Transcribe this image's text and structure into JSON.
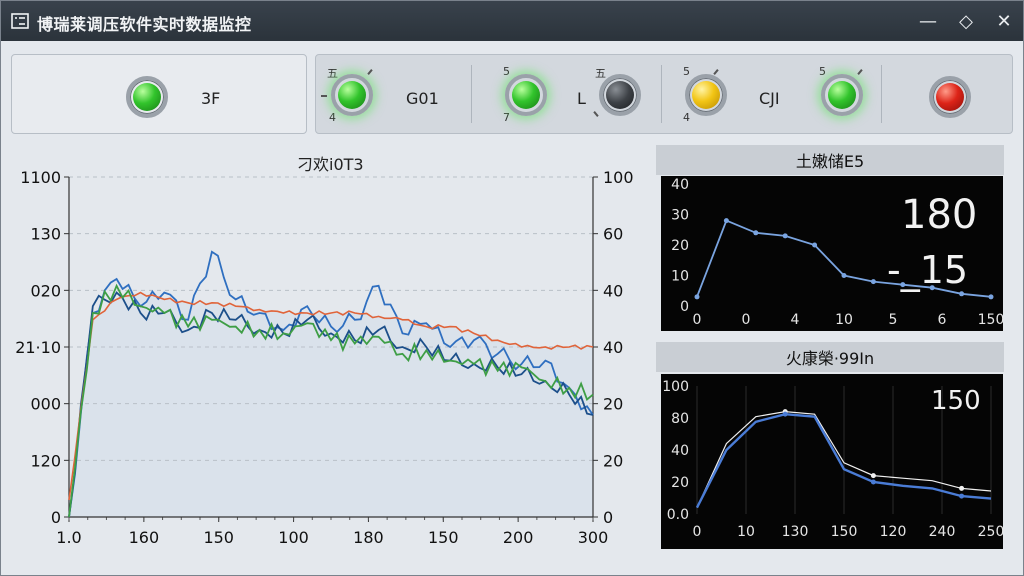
{
  "window": {
    "title": "博瑞莱调压软件实时数据监控",
    "minimize_glyph": "—",
    "restore_glyph": "◇",
    "close_glyph": "✕"
  },
  "status_panel": {
    "left_lamp": {
      "color": "green",
      "label": "3F"
    },
    "lamps": [
      {
        "color": "green",
        "label": "G01",
        "top": "五",
        "bottom": "4"
      },
      {
        "color": "green",
        "label": "",
        "top": "5",
        "bottom": "7"
      },
      {
        "color": "black",
        "label": "L",
        "top": "五",
        "bottom": ""
      },
      {
        "color": "yellow",
        "label": "CJI",
        "top": "5",
        "bottom": "4"
      },
      {
        "color": "green",
        "label": "",
        "top": "5",
        "bottom": ""
      },
      {
        "color": "red",
        "label": "",
        "top": "",
        "bottom": ""
      }
    ]
  },
  "chart_data": [
    {
      "type": "line",
      "title": "刁欢i0T3",
      "categories": [
        "1.0",
        "160",
        "150",
        "100",
        "180",
        "150",
        "200",
        "300"
      ],
      "left_ticks": [
        "1100",
        "130",
        "020",
        "21·10",
        "000",
        "120",
        "0"
      ],
      "right_ticks": [
        "100",
        "60",
        "40",
        "40",
        "20",
        "20",
        "0"
      ],
      "series": [
        {
          "color": "#2f6fc0",
          "values": [
            0,
            60,
            70,
            62,
            66,
            58,
            78,
            64,
            60,
            55,
            62,
            56,
            58,
            68,
            54,
            57,
            50,
            52,
            48,
            45,
            46,
            38,
            30
          ]
        },
        {
          "color": "#1c4f8a",
          "values": [
            0,
            62,
            66,
            60,
            60,
            55,
            60,
            58,
            55,
            54,
            58,
            54,
            52,
            55,
            50,
            50,
            46,
            45,
            44,
            42,
            40,
            36,
            30
          ]
        },
        {
          "color": "#e0643a",
          "values": [
            5,
            58,
            64,
            66,
            64,
            63,
            63,
            62,
            61,
            60,
            60,
            60,
            60,
            59,
            58,
            56,
            56,
            54,
            52,
            50,
            50,
            50,
            50
          ]
        },
        {
          "color": "#3e9e45",
          "values": [
            0,
            60,
            68,
            62,
            60,
            56,
            58,
            56,
            55,
            54,
            57,
            52,
            51,
            53,
            48,
            49,
            46,
            45,
            43,
            44,
            40,
            38,
            36
          ]
        }
      ]
    },
    {
      "type": "line",
      "title": "土嫩储E5",
      "x_ticks": [
        "0",
        "0",
        "4",
        "10",
        "5",
        "6",
        "150"
      ],
      "y_ticks": [
        "40",
        "30",
        "20",
        "10",
        "0"
      ],
      "big_value": "180",
      "small_value": "-_15",
      "series": [
        {
          "color": "#7aa4e0",
          "values": [
            3,
            28,
            24,
            23,
            20,
            10,
            8,
            7,
            6,
            4,
            3
          ]
        }
      ]
    },
    {
      "type": "line",
      "title": "火康榮·99In",
      "x_ticks": [
        "0",
        "10",
        "130",
        "150",
        "120",
        "240",
        "250"
      ],
      "y_ticks": [
        "100",
        "80",
        "40",
        "20",
        "0.0"
      ],
      "big_value": "150",
      "series": [
        {
          "color": "#f0f0f0",
          "values": [
            5,
            55,
            76,
            80,
            78,
            40,
            30,
            28,
            26,
            20,
            18
          ]
        },
        {
          "color": "#4a7cd6",
          "values": [
            5,
            50,
            72,
            78,
            76,
            35,
            25,
            22,
            20,
            14,
            12
          ]
        }
      ]
    }
  ]
}
